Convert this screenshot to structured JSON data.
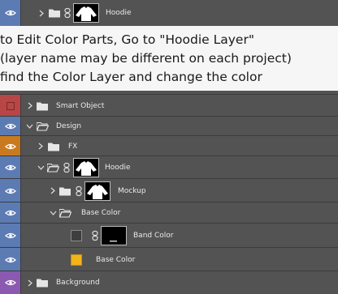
{
  "colors": {
    "panel": "#535353",
    "eye_blue": "#5d7bb3",
    "eye_red": "#b84646",
    "eye_orange": "#c97a1f",
    "eye_purple": "#8b5ab0",
    "swatch_yellow": "#f2b31b",
    "swatch_dark": "#3e3e3e"
  },
  "instructions": {
    "line1": "to Edit Color Parts, Go to \"Hoodie Layer\"",
    "line2": "(layer name may be different on each project)",
    "line3": "find the Color Layer and change the color"
  },
  "layers": {
    "hoodie_top": "Hoodie",
    "smart_object": "Smart Object",
    "design": "Design",
    "fx": "FX",
    "hoodie": "Hoodie",
    "mockup": "Mockup",
    "base_color_group": "Base Color",
    "band_color": "Band Color",
    "base_color": "Base Color",
    "background": "Background"
  },
  "icons": {
    "visibility": "eye-icon",
    "expand": "chevron-right-icon",
    "collapse": "chevron-down-icon",
    "group": "folder-icon",
    "link": "chain-link-icon",
    "thumbnail": "hoodie-thumbnail"
  }
}
